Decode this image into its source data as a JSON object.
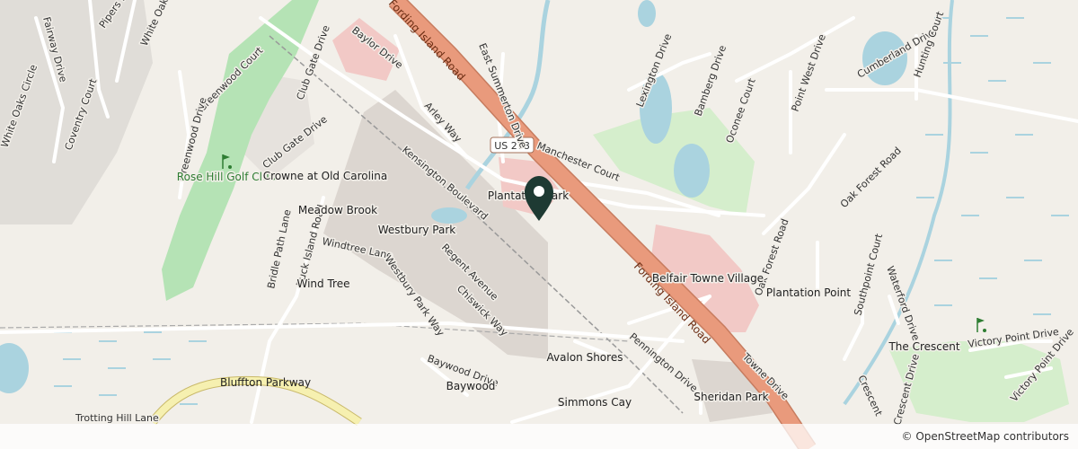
{
  "map": {
    "colors": {
      "background": "#f2efe9",
      "water": "#aad3df",
      "park": "#c8facc",
      "golf": "#b5e3b5",
      "commercial": "#d9d0c9",
      "retail": "#f2c9c6",
      "motorway": "#e99a7c",
      "secondary": "#f6f0b0",
      "residential_road": "#ffffff",
      "marker": "#1e3a33"
    },
    "shields": {
      "us278": "US 278"
    },
    "roads": {
      "fording_island_road": "Fording Island Road",
      "bluffton_parkway": "Bluffton Parkway",
      "baylor_drive": "Baylor Drive",
      "east_summerton_drive": "East Summerton Drive",
      "arley_way": "Arley Way",
      "manchester_court": "Manchester Court",
      "kensington_boulevard": "Kensington Boulevard",
      "lexington_drive": "Lexington Drive",
      "bamberg_drive": "Bamberg Drive",
      "oconee_court": "Oconee Court",
      "point_west_drive": "Point West Drive",
      "cumberland_drive": "Cumberland Drive",
      "hunting_court": "Hunting Court",
      "oak_forest_road_1": "Oak Forest Road",
      "oak_forest_road_2": "Oak Forest Road",
      "pipers_pond": "Pipers Pond",
      "white_oaks_circle_1": "White Oaks Circle",
      "white_oaks_circle_2": "White Oaks Circle",
      "fairway_drive": "Fairway Drive",
      "coventry_court": "Coventry Court",
      "greenwood_court": "Greenwood Court",
      "greenwood_drive": "Greenwood Drive",
      "club_gate_drive_1": "Club Gate Drive",
      "club_gate_drive_2": "Club Gate Drive",
      "windtree_lane": "Windtree Lane",
      "buck_island_road": "Buck Island Road",
      "bridle_path_lane": "Bridle Path Lane",
      "westbury_park_way": "Westbury Park Way",
      "regent_avenue": "Regent Avenue",
      "chiswick_way": "Chiswick Way",
      "baywood_drive": "Baywood Drive",
      "pennington_drive": "Pennington Drive",
      "towne_drive": "Towne Drive",
      "southpoint_court": "Southpoint Court",
      "waterford_drive": "Waterford Drive",
      "victory_point_drive_1": "Victory Point Drive",
      "victory_point_drive_2": "Victory Point Drive",
      "crescent_drive": "Crescent Drive",
      "trotting_hill_lane": "Trotting Hill Lane",
      "crescent_partial": "Crescent"
    },
    "places": {
      "rose_hill_golf_club": "Rose Hill Golf Club",
      "crowne_at_old_carolina": "Crowne at Old Carolina",
      "meadow_brook": "Meadow Brook",
      "westbury_park": "Westbury Park",
      "wind_tree": "Wind Tree",
      "plantation_park": "Plantation Park",
      "belfair_towne_village": "Belfair Towne Village",
      "plantation_point": "Plantation Point",
      "avalon_shores": "Avalon Shores",
      "baywood": "Baywood",
      "simmons_cay": "Simmons Cay",
      "sheridan_park": "Sheridan Park",
      "the_crescent": "The Crescent"
    },
    "marker_icon": "map-pin-marker",
    "golf_icon": "golf-flag-icon"
  },
  "attribution": "© OpenStreetMap contributors"
}
